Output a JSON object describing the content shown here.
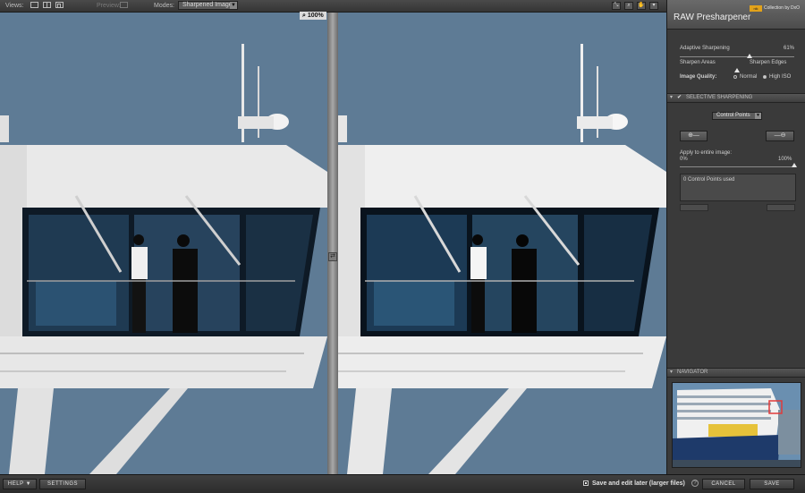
{
  "toolbar": {
    "views_label": "Views:",
    "preview_label": "Preview:",
    "modes_label": "Modes:",
    "mode_value": "Sharpened Image"
  },
  "viewer": {
    "zoom": "100%"
  },
  "panel": {
    "title": "RAW Presharpener",
    "brand": "Collection by DxO",
    "brand_badge": "nik",
    "adaptive_label": "Adaptive Sharpening",
    "adaptive_value": "61%",
    "adaptive_fraction": 0.61,
    "sharpen_left": "Sharpen Areas",
    "sharpen_right": "Sharpen Edges",
    "quality_label": "Image Quality:",
    "quality_normal": "Normal",
    "quality_high": "High ISO",
    "quality_selected": "High ISO",
    "selective_title": "SELECTIVE SHARPENING",
    "control_points_select": "Control Points",
    "apply_label": "Apply to entire image:",
    "apply_min": "0%",
    "apply_max": "100%",
    "apply_fraction": 1.0,
    "control_points_used": "0 Control Points used",
    "navigator_title": "NAVIGATOR"
  },
  "bottom": {
    "help": "HELP ▼",
    "settings": "SETTINGS",
    "save_later": "Save and edit later (larger files)",
    "cancel": "CANCEL",
    "save": "SAVE"
  }
}
